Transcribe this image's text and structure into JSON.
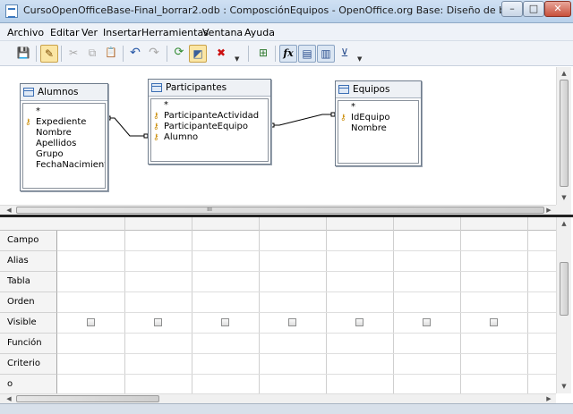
{
  "window": {
    "title": "CursoOpenOfficeBase-Final_borrar2.odb : ComposciónEquipos - OpenOffice.org Base: Diseño de busqueda",
    "minimize_label": "–",
    "maximize_label": "□",
    "close_label": "✕"
  },
  "menu": {
    "items": [
      "Archivo",
      "Editar",
      "Ver",
      "Insertar",
      "Herramientas",
      "Ventana",
      "Ayuda"
    ]
  },
  "toolbar": {
    "buttons": [
      {
        "icon": "save-icon",
        "glyph": "💾"
      },
      {
        "icon": "edit-mode-icon",
        "glyph": "✎",
        "state": "active"
      },
      {
        "icon": "cut-icon",
        "glyph": "✂"
      },
      {
        "icon": "copy-icon",
        "glyph": "⧉"
      },
      {
        "icon": "paste-icon",
        "glyph": "📋"
      },
      {
        "icon": "undo-icon",
        "glyph": "↶"
      },
      {
        "icon": "redo-icon",
        "glyph": "↷"
      },
      {
        "icon": "run-query-icon",
        "glyph": "⟳"
      },
      {
        "icon": "design-view-icon",
        "glyph": "◩",
        "state": "active"
      },
      {
        "icon": "clear-query-icon",
        "glyph": "✖"
      },
      {
        "icon": "add-tables-icon",
        "glyph": "⊞"
      },
      {
        "icon": "functions-icon",
        "glyph": "fx",
        "state": "toggled"
      },
      {
        "icon": "table-name-icon",
        "glyph": "▤",
        "state": "toggled"
      },
      {
        "icon": "alias-icon",
        "glyph": "▥",
        "state": "toggled"
      },
      {
        "icon": "distinct-values-icon",
        "glyph": "⊻"
      }
    ]
  },
  "tables": [
    {
      "name": "Alumnos",
      "fields": [
        {
          "label": "*",
          "key": false
        },
        {
          "label": "Expediente",
          "key": true
        },
        {
          "label": "Nombre",
          "key": false
        },
        {
          "label": "Apellidos",
          "key": false
        },
        {
          "label": "Grupo",
          "key": false
        },
        {
          "label": "FechaNacimiento",
          "key": false
        }
      ]
    },
    {
      "name": "Participantes",
      "fields": [
        {
          "label": "*",
          "key": false
        },
        {
          "label": "ParticipanteActividad",
          "key": true
        },
        {
          "label": "ParticipanteEquipo",
          "key": true
        },
        {
          "label": "Alumno",
          "key": true
        }
      ]
    },
    {
      "name": "Equipos",
      "fields": [
        {
          "label": "*",
          "key": false
        },
        {
          "label": "IdEquipo",
          "key": true
        },
        {
          "label": "Nombre",
          "key": false
        }
      ]
    }
  ],
  "grid": {
    "rows": [
      "Campo",
      "Alias",
      "Tabla",
      "Orden",
      "Visible",
      "Función",
      "Criterio",
      "o"
    ],
    "column_count": 8,
    "visible_checked": [
      false,
      false,
      false,
      false,
      false,
      false,
      false
    ]
  },
  "scroll": {
    "grip": "ııı"
  }
}
